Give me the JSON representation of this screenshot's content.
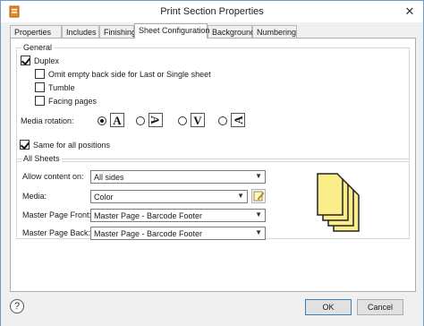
{
  "window": {
    "title": "Print Section Properties"
  },
  "tabs": [
    {
      "label": "Properties"
    },
    {
      "label": "Includes"
    },
    {
      "label": "Finishing"
    },
    {
      "label": "Sheet Configuration",
      "active": true
    },
    {
      "label": "Background"
    },
    {
      "label": "Numbering"
    }
  ],
  "general": {
    "group_label": "General",
    "duplex": {
      "label": "Duplex",
      "checked": true
    },
    "omit_empty": {
      "label": "Omit empty back side for Last or Single sheet",
      "checked": false
    },
    "tumble": {
      "label": "Tumble",
      "checked": false
    },
    "facing_pages": {
      "label": "Facing pages",
      "checked": false
    },
    "media_rotation": {
      "label": "Media rotation:",
      "options": [
        {
          "glyph": "A",
          "selected": true
        },
        {
          "glyph": "A",
          "selected": false
        },
        {
          "glyph": "V",
          "selected": false
        },
        {
          "glyph": "A",
          "selected": false
        }
      ]
    }
  },
  "same_for_all": {
    "label": "Same for all positions",
    "checked": true
  },
  "all_sheets": {
    "group_label": "All Sheets",
    "allow_content_on": {
      "label": "Allow content on:",
      "value": "All sides"
    },
    "media": {
      "label": "Media:",
      "value": "Color"
    },
    "master_front": {
      "label": "Master Page Front:",
      "value": "Master Page - Barcode Footer"
    },
    "master_back": {
      "label": "Master Page Back:",
      "value": "Master Page - Barcode Footer"
    }
  },
  "illustration": {
    "sheet_color": "#fbee8a",
    "sheet_border": "#222222"
  },
  "footer": {
    "ok_label": "OK",
    "cancel_label": "Cancel",
    "help_glyph": "?"
  },
  "colors": {
    "border_accent": "#6b9ac8",
    "default_button_border": "#3c7fb1"
  }
}
